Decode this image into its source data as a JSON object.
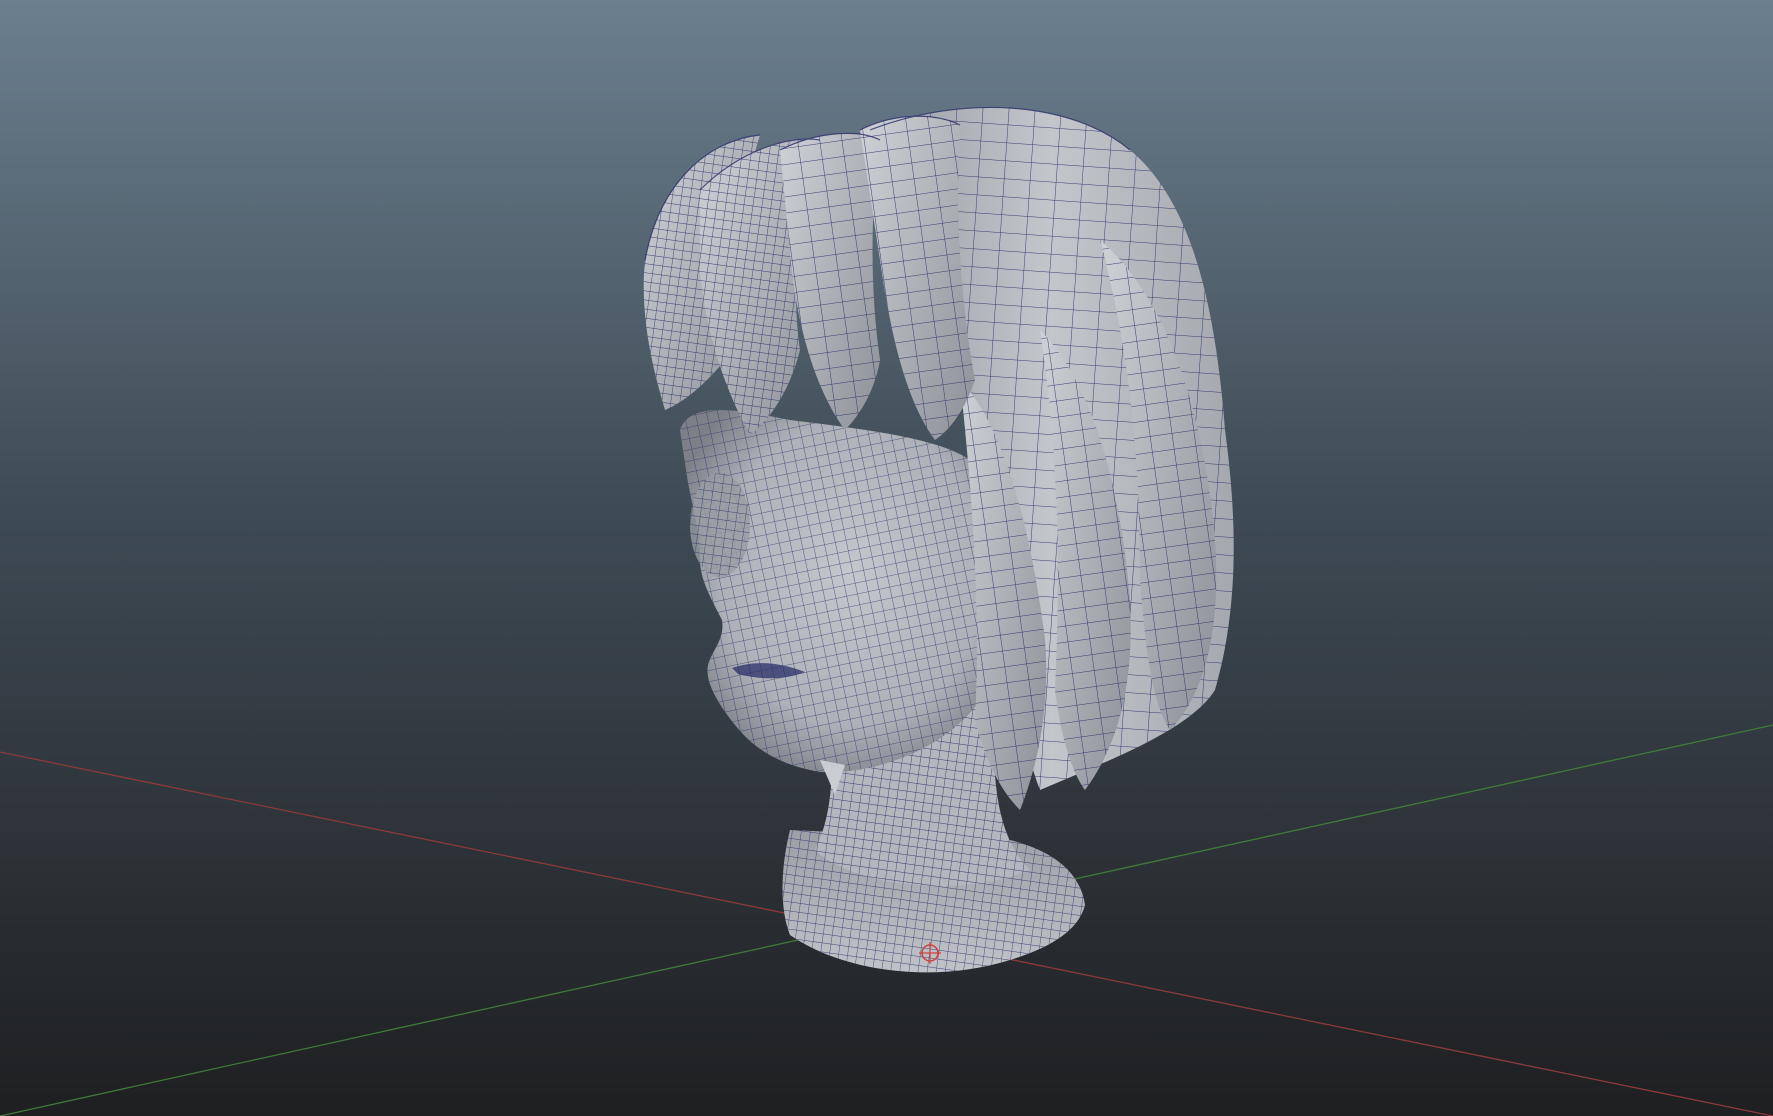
{
  "viewport": {
    "background_top_color": "#6b7f8f",
    "background_bottom_color": "#1e1f21",
    "grid_x_axis_color": "#8a3a3a",
    "grid_z_axis_color": "#3f7a3a",
    "mesh_surface_color": "#b9bcc2",
    "mesh_shadow_color": "#6f7278",
    "wireframe_color": "#2a2f6a",
    "pivot_marker_color": "#d04040"
  },
  "scene": {
    "model": "stylized-female-head-with-bob-hair",
    "display_mode": "wireframe-on-shaded",
    "pivot_icon": "pivot-crosshair-icon"
  }
}
